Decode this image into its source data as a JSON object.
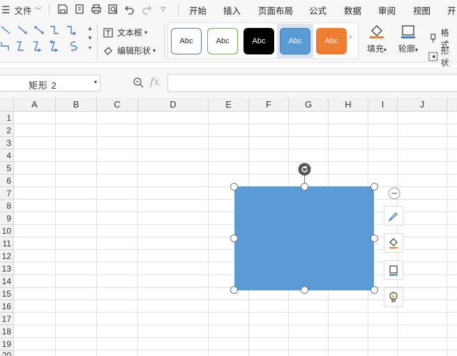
{
  "menubar": {
    "file_label": "文件",
    "tabs": [
      "开始",
      "插入",
      "页面布局",
      "公式",
      "数据",
      "审阅",
      "视图",
      "开"
    ]
  },
  "ribbon": {
    "textbox_label": "文本框",
    "edit_shape_label": "编辑形状",
    "style_labels": [
      "Abc",
      "Abc",
      "Abc",
      "Abc",
      "Abc"
    ],
    "fill_label": "填充",
    "outline_label": "轮廓",
    "format_label": "格式",
    "shape_label": "形状"
  },
  "formula": {
    "namebox_value": "矩形 2",
    "fx_label": "fx",
    "input_value": ""
  },
  "grid": {
    "columns": [
      "A",
      "B",
      "C",
      "D",
      "E",
      "F",
      "G",
      "H",
      "I",
      "J"
    ],
    "rows": [
      "1",
      "2",
      "3",
      "4",
      "5",
      "6",
      "7",
      "8",
      "9",
      "10",
      "11",
      "12",
      "13",
      "14",
      "15",
      "16",
      "17",
      "18",
      "19",
      "20"
    ]
  },
  "colors": {
    "shape_fill": "#5b9bd5",
    "style_black": "#000000",
    "style_blue": "#5b9bd5",
    "style_orange": "#ed7d31"
  }
}
